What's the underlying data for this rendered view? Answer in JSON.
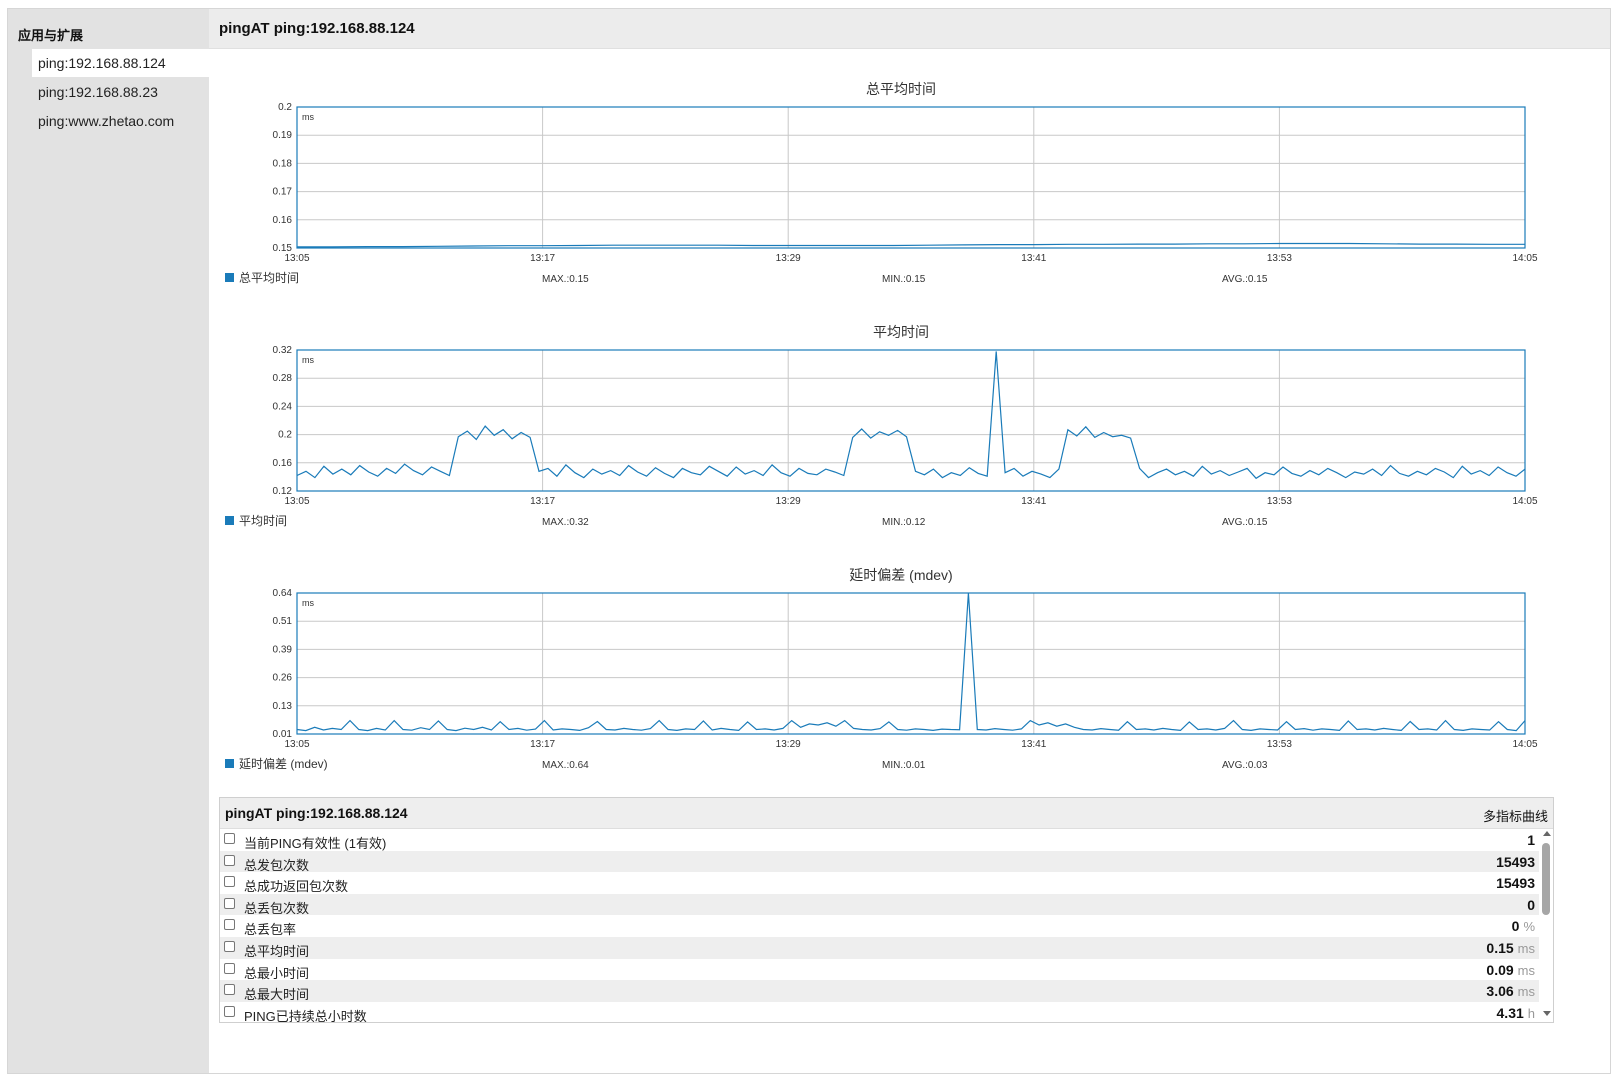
{
  "sidebar": {
    "title": "应用与扩展",
    "items": [
      {
        "label": "ping:192.168.88.124",
        "active": true
      },
      {
        "label": "ping:192.168.88.23",
        "active": false
      },
      {
        "label": "ping:www.zhetao.com",
        "active": false
      }
    ]
  },
  "header": {
    "title": "pingAT ping:192.168.88.124"
  },
  "colors": {
    "series": "#1a7bb9",
    "grid": "#c8c8c8",
    "border": "#1a7bb9"
  },
  "chart_data": [
    {
      "type": "line",
      "title": "总平均时间",
      "unit": "ms",
      "x_ticks": [
        "13:05",
        "13:17",
        "13:29",
        "13:41",
        "13:53",
        "14:05"
      ],
      "y_ticks": [
        "0.2",
        "0.19",
        "0.18",
        "0.17",
        "0.16",
        "0.15"
      ],
      "ylim": [
        0.15,
        0.2
      ],
      "legend": "总平均时间",
      "max_label": "MAX.:0.15",
      "min_label": "MIN.:0.15",
      "avg_label": "AVG.:0.15",
      "series": [
        {
          "name": "总平均时间",
          "values": [
            0.1504,
            0.1504,
            0.1505,
            0.1505,
            0.1506,
            0.1507,
            0.1508,
            0.1508,
            0.1509,
            0.151,
            0.151,
            0.151,
            0.151,
            0.1509,
            0.1509,
            0.1509,
            0.1509,
            0.1509,
            0.151,
            0.1511,
            0.1512,
            0.1512,
            0.1513,
            0.1513,
            0.1514,
            0.1514,
            0.1515,
            0.1515,
            0.1516,
            0.1516,
            0.1516,
            0.1515,
            0.1514,
            0.1514,
            0.1513,
            0.1513
          ]
        }
      ]
    },
    {
      "type": "line",
      "title": "平均时间",
      "unit": "ms",
      "x_ticks": [
        "13:05",
        "13:17",
        "13:29",
        "13:41",
        "13:53",
        "14:05"
      ],
      "y_ticks": [
        "0.32",
        "0.28",
        "0.24",
        "0.2",
        "0.16",
        "0.12"
      ],
      "ylim": [
        0.12,
        0.32
      ],
      "legend": "平均时间",
      "max_label": "MAX.:0.32",
      "min_label": "MIN.:0.12",
      "avg_label": "AVG.:0.15",
      "series": [
        {
          "name": "平均时间",
          "values": [
            0.142,
            0.148,
            0.139,
            0.155,
            0.144,
            0.151,
            0.143,
            0.156,
            0.147,
            0.141,
            0.152,
            0.145,
            0.158,
            0.149,
            0.143,
            0.154,
            0.148,
            0.142,
            0.197,
            0.205,
            0.193,
            0.212,
            0.199,
            0.207,
            0.194,
            0.203,
            0.196,
            0.148,
            0.152,
            0.141,
            0.157,
            0.146,
            0.139,
            0.151,
            0.144,
            0.149,
            0.142,
            0.156,
            0.147,
            0.141,
            0.153,
            0.145,
            0.139,
            0.152,
            0.146,
            0.143,
            0.155,
            0.148,
            0.141,
            0.154,
            0.144,
            0.149,
            0.142,
            0.157,
            0.146,
            0.141,
            0.152,
            0.145,
            0.143,
            0.151,
            0.147,
            0.142,
            0.196,
            0.208,
            0.195,
            0.204,
            0.199,
            0.206,
            0.197,
            0.148,
            0.143,
            0.151,
            0.139,
            0.146,
            0.142,
            0.153,
            0.145,
            0.141,
            0.318,
            0.146,
            0.152,
            0.141,
            0.148,
            0.144,
            0.139,
            0.151,
            0.207,
            0.198,
            0.211,
            0.196,
            0.203,
            0.197,
            0.199,
            0.195,
            0.152,
            0.139,
            0.146,
            0.151,
            0.143,
            0.148,
            0.141,
            0.155,
            0.144,
            0.149,
            0.142,
            0.147,
            0.152,
            0.138,
            0.146,
            0.143,
            0.154,
            0.145,
            0.141,
            0.149,
            0.143,
            0.152,
            0.146,
            0.139,
            0.147,
            0.144,
            0.151,
            0.142,
            0.156,
            0.145,
            0.141,
            0.148,
            0.143,
            0.152,
            0.147,
            0.139,
            0.155,
            0.144,
            0.149,
            0.142,
            0.154,
            0.146,
            0.141,
            0.151
          ]
        }
      ]
    },
    {
      "type": "line",
      "title": "延时偏差 (mdev)",
      "unit": "ms",
      "x_ticks": [
        "13:05",
        "13:17",
        "13:29",
        "13:41",
        "13:53",
        "14:05"
      ],
      "y_ticks": [
        "0.64",
        "0.51",
        "0.39",
        "0.26",
        "0.13",
        "0.01"
      ],
      "ylim": [
        0.01,
        0.64
      ],
      "legend": "延时偏差 (mdev)",
      "max_label": "MAX.:0.64",
      "min_label": "MIN.:0.01",
      "avg_label": "AVG.:0.03",
      "series": [
        {
          "name": "延时偏差 (mdev)",
          "values": [
            0.03,
            0.025,
            0.04,
            0.028,
            0.035,
            0.03,
            0.07,
            0.03,
            0.025,
            0.035,
            0.028,
            0.07,
            0.03,
            0.027,
            0.038,
            0.03,
            0.068,
            0.03,
            0.025,
            0.036,
            0.03,
            0.04,
            0.028,
            0.065,
            0.03,
            0.035,
            0.027,
            0.032,
            0.07,
            0.028,
            0.033,
            0.03,
            0.026,
            0.038,
            0.066,
            0.03,
            0.028,
            0.035,
            0.03,
            0.027,
            0.034,
            0.07,
            0.03,
            0.026,
            0.033,
            0.03,
            0.068,
            0.028,
            0.035,
            0.03,
            0.026,
            0.064,
            0.03,
            0.033,
            0.028,
            0.035,
            0.07,
            0.04,
            0.055,
            0.05,
            0.06,
            0.045,
            0.07,
            0.035,
            0.03,
            0.028,
            0.034,
            0.064,
            0.03,
            0.027,
            0.033,
            0.03,
            0.026,
            0.032,
            0.03,
            0.029,
            0.64,
            0.03,
            0.028,
            0.034,
            0.03,
            0.027,
            0.033,
            0.07,
            0.05,
            0.06,
            0.045,
            0.055,
            0.04,
            0.03,
            0.028,
            0.034,
            0.03,
            0.027,
            0.065,
            0.03,
            0.033,
            0.028,
            0.035,
            0.03,
            0.026,
            0.064,
            0.03,
            0.033,
            0.028,
            0.035,
            0.07,
            0.03,
            0.026,
            0.033,
            0.03,
            0.028,
            0.065,
            0.03,
            0.034,
            0.027,
            0.033,
            0.03,
            0.026,
            0.068,
            0.03,
            0.033,
            0.028,
            0.035,
            0.03,
            0.026,
            0.066,
            0.03,
            0.033,
            0.028,
            0.07,
            0.03,
            0.026,
            0.033,
            0.03,
            0.028,
            0.065,
            0.03,
            0.025,
            0.07
          ]
        }
      ]
    }
  ],
  "metrics": {
    "title": "pingAT ping:192.168.88.124",
    "link": "多指标曲线",
    "rows": [
      {
        "label": "当前PING有效性 (1有效)",
        "value": "1",
        "unit": ""
      },
      {
        "label": "总发包次数",
        "value": "15493",
        "unit": ""
      },
      {
        "label": "总成功返回包次数",
        "value": "15493",
        "unit": ""
      },
      {
        "label": "总丢包次数",
        "value": "0",
        "unit": ""
      },
      {
        "label": "总丢包率",
        "value": "0",
        "unit": "%"
      },
      {
        "label": "总平均时间",
        "value": "0.15",
        "unit": "ms"
      },
      {
        "label": "总最小时间",
        "value": "0.09",
        "unit": "ms"
      },
      {
        "label": "总最大时间",
        "value": "3.06",
        "unit": "ms"
      },
      {
        "label": "PING已持续总小时数",
        "value": "4.31",
        "unit": "h"
      }
    ]
  }
}
